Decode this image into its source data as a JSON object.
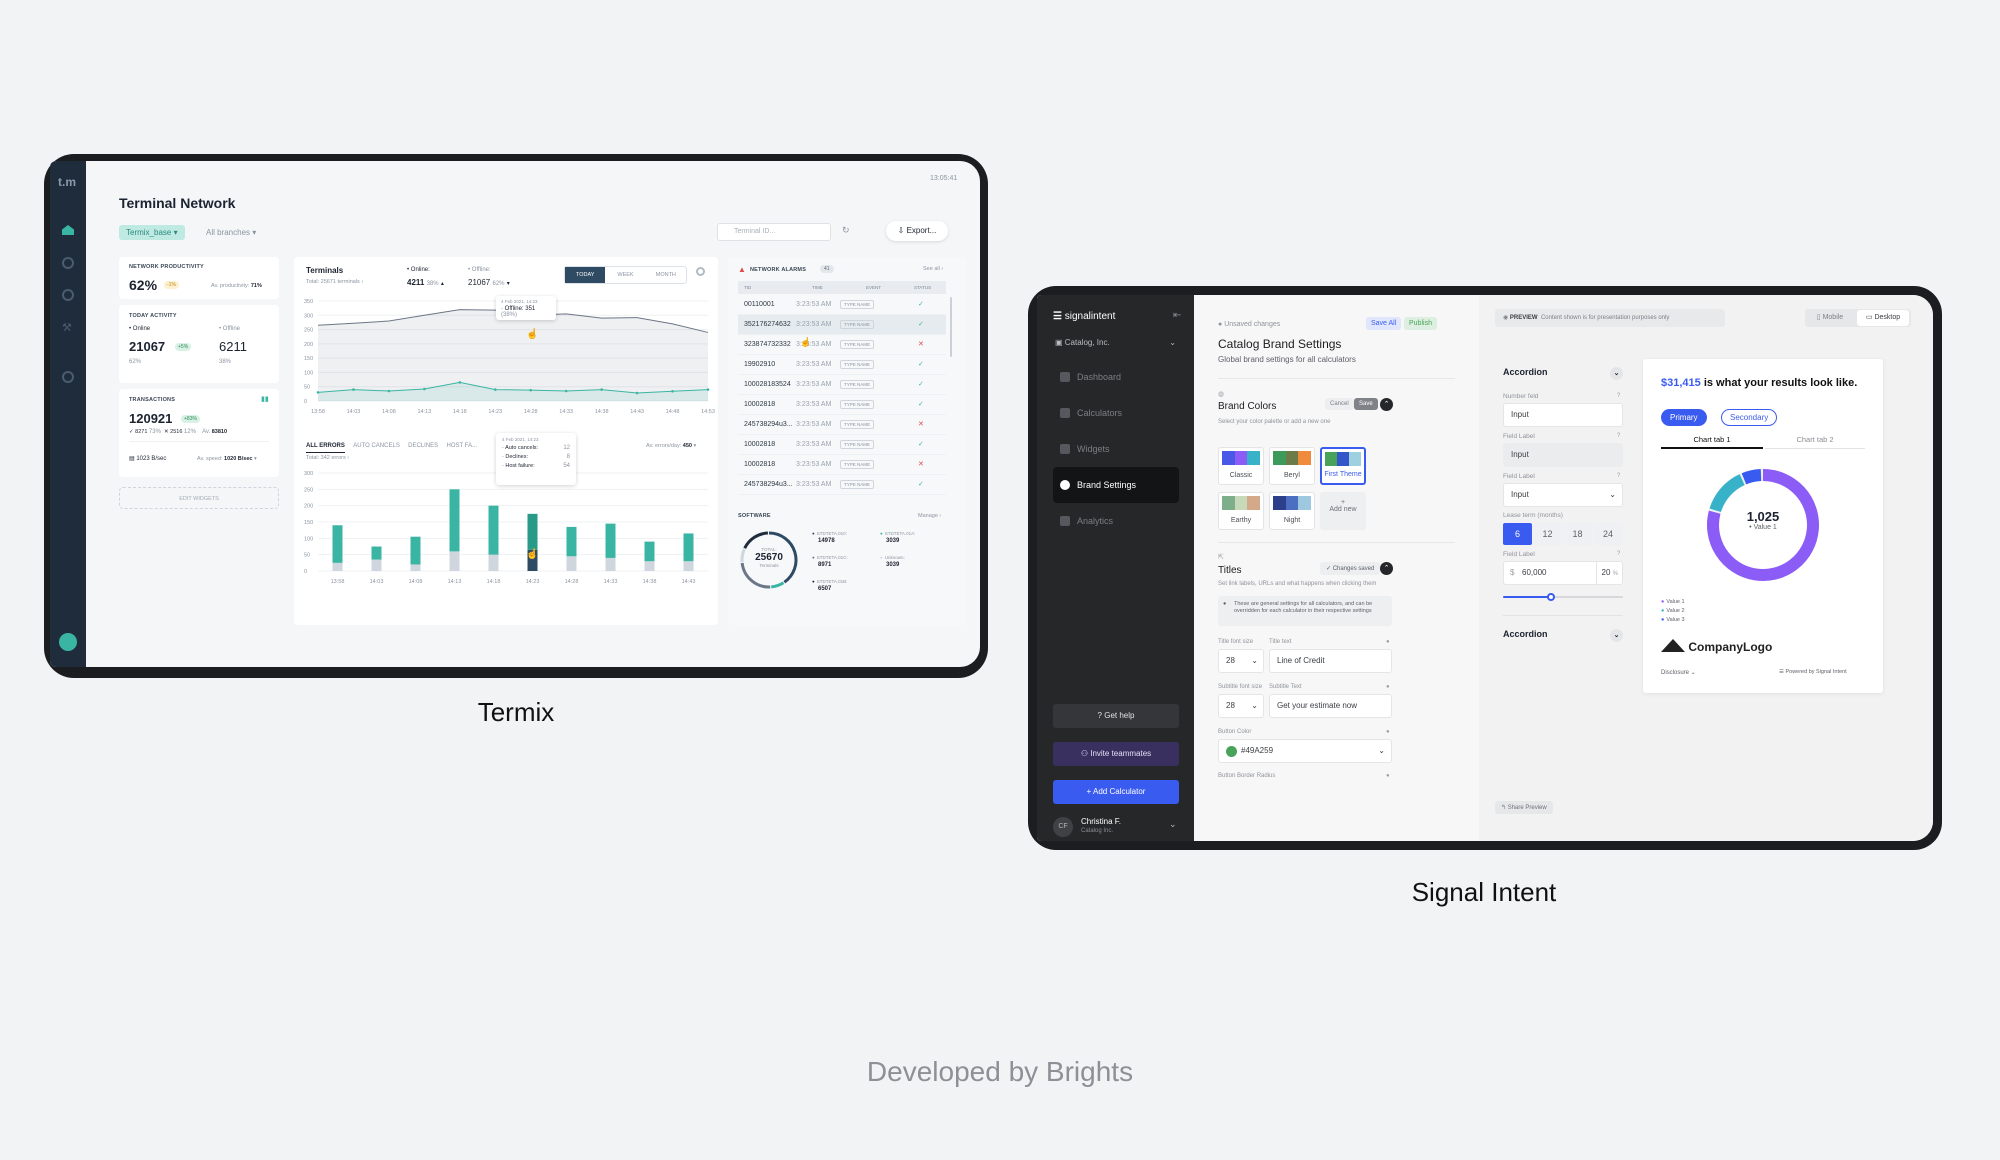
{
  "termix": {
    "caption": "Termix",
    "logo": "t.m",
    "title": "Terminal Network",
    "clock": "13:05:41",
    "filter_chip": "Termix_base",
    "branches": "All branches",
    "search_placeholder": "Terminal ID...",
    "export_label": "Export...",
    "network_productivity": {
      "label": "NETWORK PRODUCTIVITY",
      "value": "62%",
      "badge": "-1%",
      "sub": "Av. productivity:",
      "sub_value": "71%"
    },
    "today_activity": {
      "label": "TODAY ACTIVITY",
      "online_label": "Online",
      "offline_label": "Offline",
      "online_value": "21067",
      "online_badge": "+5%",
      "offline_value": "6211",
      "online_pct": "62%",
      "offline_pct": "38%"
    },
    "transactions": {
      "label": "TRANSACTIONS",
      "value": "120921",
      "badge": "+83%",
      "ok": "8271",
      "ok_pct": "73%",
      "fail": "2516",
      "fail_pct": "12%",
      "av_label": "Av.",
      "av_value": "83810",
      "speed": "1023 B/sec",
      "av_speed_label": "Av. speed:",
      "av_speed": "1020 B/sec"
    },
    "edit_widgets": "EDIT WIDGETS",
    "terminals": {
      "title": "Terminals",
      "total": "Total: 25671 terminals",
      "online_label": "Online:",
      "online_value": "4211",
      "online_pct": "38%",
      "offline_label": "Offline:",
      "offline_value": "21067",
      "offline_pct": "62%",
      "tabs": [
        "TODAY",
        "WEEK",
        "MONTH"
      ],
      "tooltip_date": "4 Feb 2021, 14:23",
      "tooltip_text": "Offline: 351",
      "tooltip_pct": "(38%)"
    },
    "errors": {
      "tabs": [
        "ALL ERRORS",
        "AUTO CANCELS",
        "DECLINES",
        "HOST FA..."
      ],
      "total": "Total: 342 errors",
      "av_label": "Av. errors/day:",
      "av_value": "450",
      "tooltip_date": "4 Feb 2021, 14:23",
      "tooltip_rows": [
        {
          "label": "Auto cancels:",
          "value": "12"
        },
        {
          "label": "Declines:",
          "value": "8"
        },
        {
          "label": "Host failure:",
          "value": "54"
        }
      ]
    },
    "alarms": {
      "title": "NETWORK ALARMS",
      "count": "41",
      "see_all": "See all",
      "columns": [
        "TID",
        "TIME",
        "EVENT",
        "STATUS"
      ],
      "type_label": "TYPE NAME",
      "rows": [
        {
          "tid": "00110001",
          "time": "3:23:53 AM",
          "status": "ok"
        },
        {
          "tid": "352176274632",
          "time": "3:23:53 AM",
          "status": "ok"
        },
        {
          "tid": "323874732332",
          "time": "3:23:53 AM",
          "status": "fail"
        },
        {
          "tid": "19902910",
          "time": "3:23:53 AM",
          "status": "ok"
        },
        {
          "tid": "100028183524",
          "time": "3:23:53 AM",
          "status": "ok"
        },
        {
          "tid": "10002818",
          "time": "3:23:53 AM",
          "status": "ok"
        },
        {
          "tid": "245738294u3...",
          "time": "3:23:53 AM",
          "status": "fail"
        },
        {
          "tid": "10002818",
          "time": "3:23:53 AM",
          "status": "ok"
        },
        {
          "tid": "10002818",
          "time": "3:23:53 AM",
          "status": "fail"
        },
        {
          "tid": "245738294u3...",
          "time": "3:23:53 AM",
          "status": "ok"
        }
      ]
    },
    "software": {
      "title": "SOFTWARE",
      "manage": "Manage",
      "total_label": "TOTAL:",
      "total_value": "25670",
      "total_sub": "Terminals",
      "items": [
        {
          "name": "STDTETA.010:",
          "value": "14978"
        },
        {
          "name": "STDTETA.01A:",
          "value": "3039"
        },
        {
          "name": "STDTETA.01C:",
          "value": "8971"
        },
        {
          "name": "Unknown:",
          "value": "3039"
        },
        {
          "name": "STDTETA.01B:",
          "value": "6507"
        }
      ]
    },
    "colors": {
      "sidebar": "#1e2c3c",
      "accent": "#3bb5a3",
      "dark_accent": "#2f4a63"
    }
  },
  "chart_data": [
    {
      "type": "line",
      "x": [
        "13:58",
        "14:03",
        "14:08",
        "14:13",
        "14:18",
        "14:23",
        "14:28",
        "14:33",
        "14:38",
        "14:43",
        "14:48",
        "14:53"
      ],
      "yticks": [
        0,
        50,
        100,
        150,
        200,
        250,
        300,
        350
      ],
      "ylim": [
        0,
        350
      ],
      "series": [
        {
          "values": [
            265,
            272,
            280,
            300,
            320,
            318,
            300,
            305,
            290,
            292,
            270,
            240
          ]
        },
        {
          "values": [
            30,
            40,
            35,
            42,
            65,
            40,
            38,
            35,
            40,
            28,
            34,
            40
          ]
        }
      ]
    },
    {
      "type": "bar",
      "categories": [
        "13:58",
        "14:03",
        "14:08",
        "14:13",
        "14:18",
        "14:23",
        "14:28",
        "14:33",
        "14:38",
        "14:43"
      ],
      "yticks": [
        0,
        50,
        100,
        150,
        200,
        250,
        300
      ],
      "ylim": [
        0,
        300
      ],
      "series": [
        {
          "values": [
            140,
            75,
            105,
            250,
            200,
            175,
            135,
            145,
            90,
            115
          ]
        },
        {
          "values": [
            25,
            35,
            20,
            60,
            50,
            65,
            45,
            40,
            30,
            30
          ]
        }
      ]
    },
    {
      "type": "pie",
      "categories": [
        "STDTETA.010",
        "STDTETA.01A",
        "STDTETA.01C",
        "Unknown",
        "STDTETA.01B"
      ],
      "values": [
        14978,
        3039,
        8971,
        3039,
        6507
      ]
    },
    {
      "type": "pie",
      "categories": [
        "Value 1",
        "Value 2",
        "Value 3"
      ],
      "values": [
        1025,
        180,
        80
      ],
      "center_value": "1,025",
      "center_label": "Value 1"
    }
  ],
  "signal": {
    "caption": "Signal Intent",
    "brand": "signalintent",
    "org": "Catalog, Inc.",
    "nav": [
      "Dashboard",
      "Calculators",
      "Widgets",
      "Brand Settings",
      "Analytics"
    ],
    "active_nav": "Brand Settings",
    "get_help": "Get help",
    "invite": "Invite teammates",
    "add_calc": "Add Calculator",
    "user_name": "Christina F.",
    "user_org": "Catalog Inc.",
    "user_initials": "CF",
    "unsaved": "Unsaved changes",
    "save_all": "Save All",
    "publish": "Publish",
    "page_title": "Catalog Brand Settings",
    "page_sub": "Global brand settings for all calculators",
    "brand_colors": "Brand Colors",
    "brand_colors_sub": "Select your color palette or add a new one",
    "cancel": "Cancel",
    "save": "Save",
    "palettes": [
      {
        "name": "Classic",
        "c": [
          "#4a58e8",
          "#8b5cf6",
          "#38b2c8"
        ]
      },
      {
        "name": "Beryl",
        "c": [
          "#3c9a5a",
          "#6b7c48",
          "#f08a3c"
        ]
      },
      {
        "name": "First Theme",
        "c": [
          "#49a259",
          "#3556c8",
          "#9fd0e0"
        ]
      },
      {
        "name": "Earthy",
        "c": [
          "#7fae8a",
          "#c7d9b8",
          "#d4a98a"
        ]
      },
      {
        "name": "Night",
        "c": [
          "#2d3e8a",
          "#4c6fc2",
          "#9dc8e0"
        ]
      }
    ],
    "add_new": "Add new",
    "titles": "Titles",
    "changes_saved": "Changes saved",
    "titles_sub": "Set link labels, URLs and what happens when clicking them",
    "info": "These are general settings for all calculators, and can be overridden for each calculator in their respective settings",
    "title_font_size_label": "Title font size",
    "title_text_label": "Title text",
    "title_font_size": "28",
    "title_text": "Line of Credit",
    "subtitle_font_size_label": "Subtitle font size",
    "subtitle_text_label": "Subtitle Text",
    "subtitle_font_size": "28",
    "subtitle_text": "Get your estimate now",
    "button_color_label": "Button Color",
    "button_color": "#49A259",
    "border_radius_label": "Button Border Radius",
    "preview_label": "PREVIEW",
    "preview_note": "Content shown is for presentation purposes only",
    "mobile": "Mobile",
    "desktop": "Desktop",
    "accordion": "Accordion",
    "number_field": "Number feld",
    "input": "Input",
    "field_label": "Field Label",
    "lease_term": "Lease term (months)",
    "lease_options": [
      "6",
      "12",
      "18",
      "24"
    ],
    "dollar": "$",
    "amount": "60,000",
    "pct": "20",
    "pct_sign": "%",
    "slider_fraction": 0.4,
    "result_amount": "$31,415",
    "result_text": "is what your results look like.",
    "primary": "Primary",
    "secondary": "Secondary",
    "chart_tabs": [
      "Chart tab 1",
      "Chart tab 2"
    ],
    "company": "CompanyLogo",
    "disclosure": "Disclosure",
    "powered": "Powered by Signal Intent",
    "share_preview": "Share Preview",
    "colors": {
      "sidebar": "#262729",
      "blue": "#3a5bf0",
      "purple": "#8b5cf6"
    }
  },
  "footer": "Developed by Brights"
}
